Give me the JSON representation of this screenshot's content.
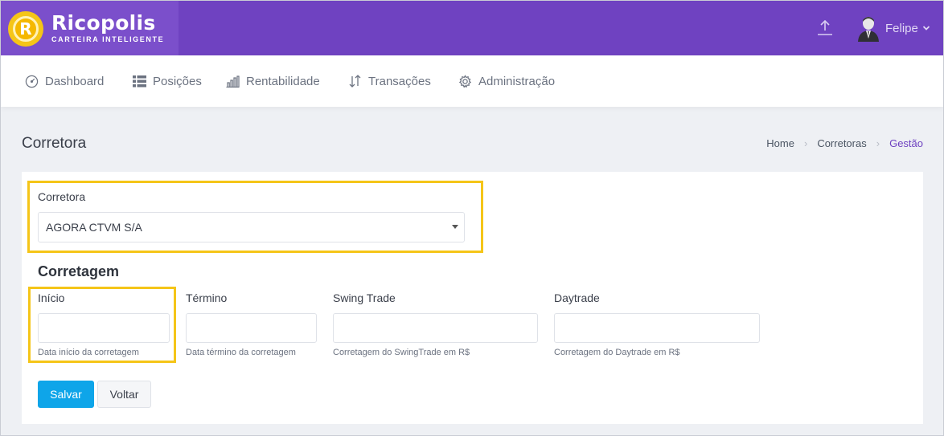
{
  "brand": {
    "name": "Ricopolis",
    "tagline": "CARTEIRA INTELIGENTE",
    "logo_letter": "R"
  },
  "user": {
    "name": "Felipe"
  },
  "icons": {
    "upload": "upload-icon",
    "avatar": "user-avatar",
    "chevron": "chevron-down-icon"
  },
  "nav": {
    "items": [
      {
        "label": "Dashboard",
        "icon": "dashboard-icon"
      },
      {
        "label": "Posições",
        "icon": "table-icon"
      },
      {
        "label": "Rentabilidade",
        "icon": "bar-chart-icon"
      },
      {
        "label": "Transações",
        "icon": "transfer-icon"
      },
      {
        "label": "Administração",
        "icon": "gear-icon"
      }
    ]
  },
  "page": {
    "title": "Corretora"
  },
  "breadcrumb": [
    "Home",
    "Corretoras",
    "Gestão"
  ],
  "form": {
    "corretora_label": "Corretora",
    "corretora_value": "AGORA CTVM S/A",
    "section_title": "Corretagem",
    "fields": [
      {
        "label": "Início",
        "value": "",
        "help": "Data início da corretagem"
      },
      {
        "label": "Término",
        "value": "",
        "help": "Data término da corretagem"
      },
      {
        "label": "Swing Trade",
        "value": "",
        "help": "Corretagem do SwingTrade em R$"
      },
      {
        "label": "Daytrade",
        "value": "",
        "help": "Corretagem do Daytrade em R$"
      }
    ],
    "save_label": "Salvar",
    "back_label": "Voltar"
  },
  "colors": {
    "primary": "#6f42c1",
    "highlight": "#f5c518",
    "button": "#0ea5e9"
  }
}
